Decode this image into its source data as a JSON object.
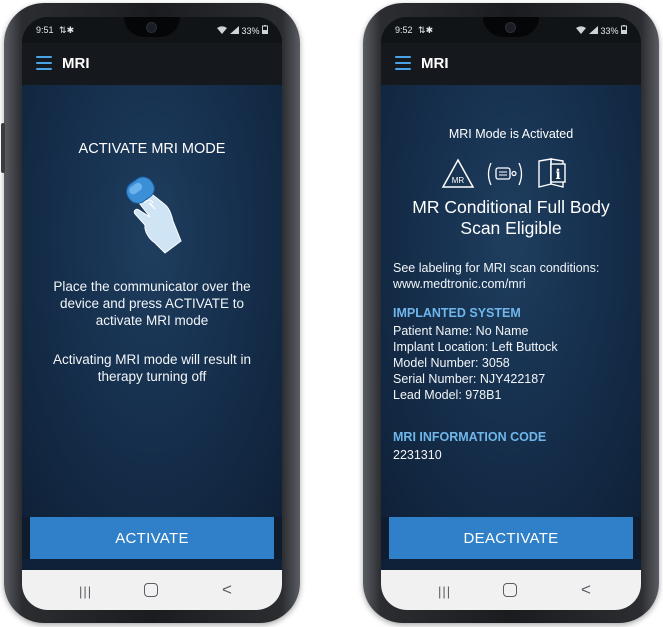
{
  "left_phone": {
    "status": {
      "time": "9:51",
      "notification_icons": "⇅✱",
      "battery": "33%"
    },
    "app_bar": {
      "title": "MRI"
    },
    "heading": "ACTIVATE MRI MODE",
    "instruction_1_lines": [
      "Place the communicator over the",
      "device and press ACTIVATE to",
      "activate MRI mode"
    ],
    "instruction_2_lines": [
      "Activating MRI mode will result in",
      "therapy turning off"
    ],
    "button_label": "ACTIVATE",
    "nav": {
      "recent": "|||",
      "back": "<"
    }
  },
  "right_phone": {
    "status": {
      "time": "9:52",
      "notification_icons": "⇅✱",
      "battery": "33%"
    },
    "app_bar": {
      "title": "MRI"
    },
    "mode_status": "MRI Mode is Activated",
    "icons": {
      "mr_label": "MR",
      "info_label": "i"
    },
    "eligibility_lines": [
      "MR Conditional Full Body",
      "Scan Eligible"
    ],
    "labeling_lines": [
      "See labeling for MRI scan conditions:",
      "www.medtronic.com/mri"
    ],
    "implanted_system": {
      "header": "IMPLANTED SYSTEM",
      "patient_name": "Patient Name: No Name",
      "implant_location": "Implant Location: Left Buttock",
      "model_number": "Model Number: 3058",
      "serial_number": "Serial Number: NJY422187",
      "lead_model": "Lead Model: 978B1"
    },
    "mri_info": {
      "header": "MRI INFORMATION CODE",
      "code": "2231310"
    },
    "button_label": "DEACTIVATE",
    "nav": {
      "recent": "|||",
      "back": "<"
    }
  },
  "colors": {
    "accent": "#2f80c8",
    "section_header": "#6fb6ea",
    "screen_bg": "#16304e",
    "app_bar": "#15191d"
  }
}
